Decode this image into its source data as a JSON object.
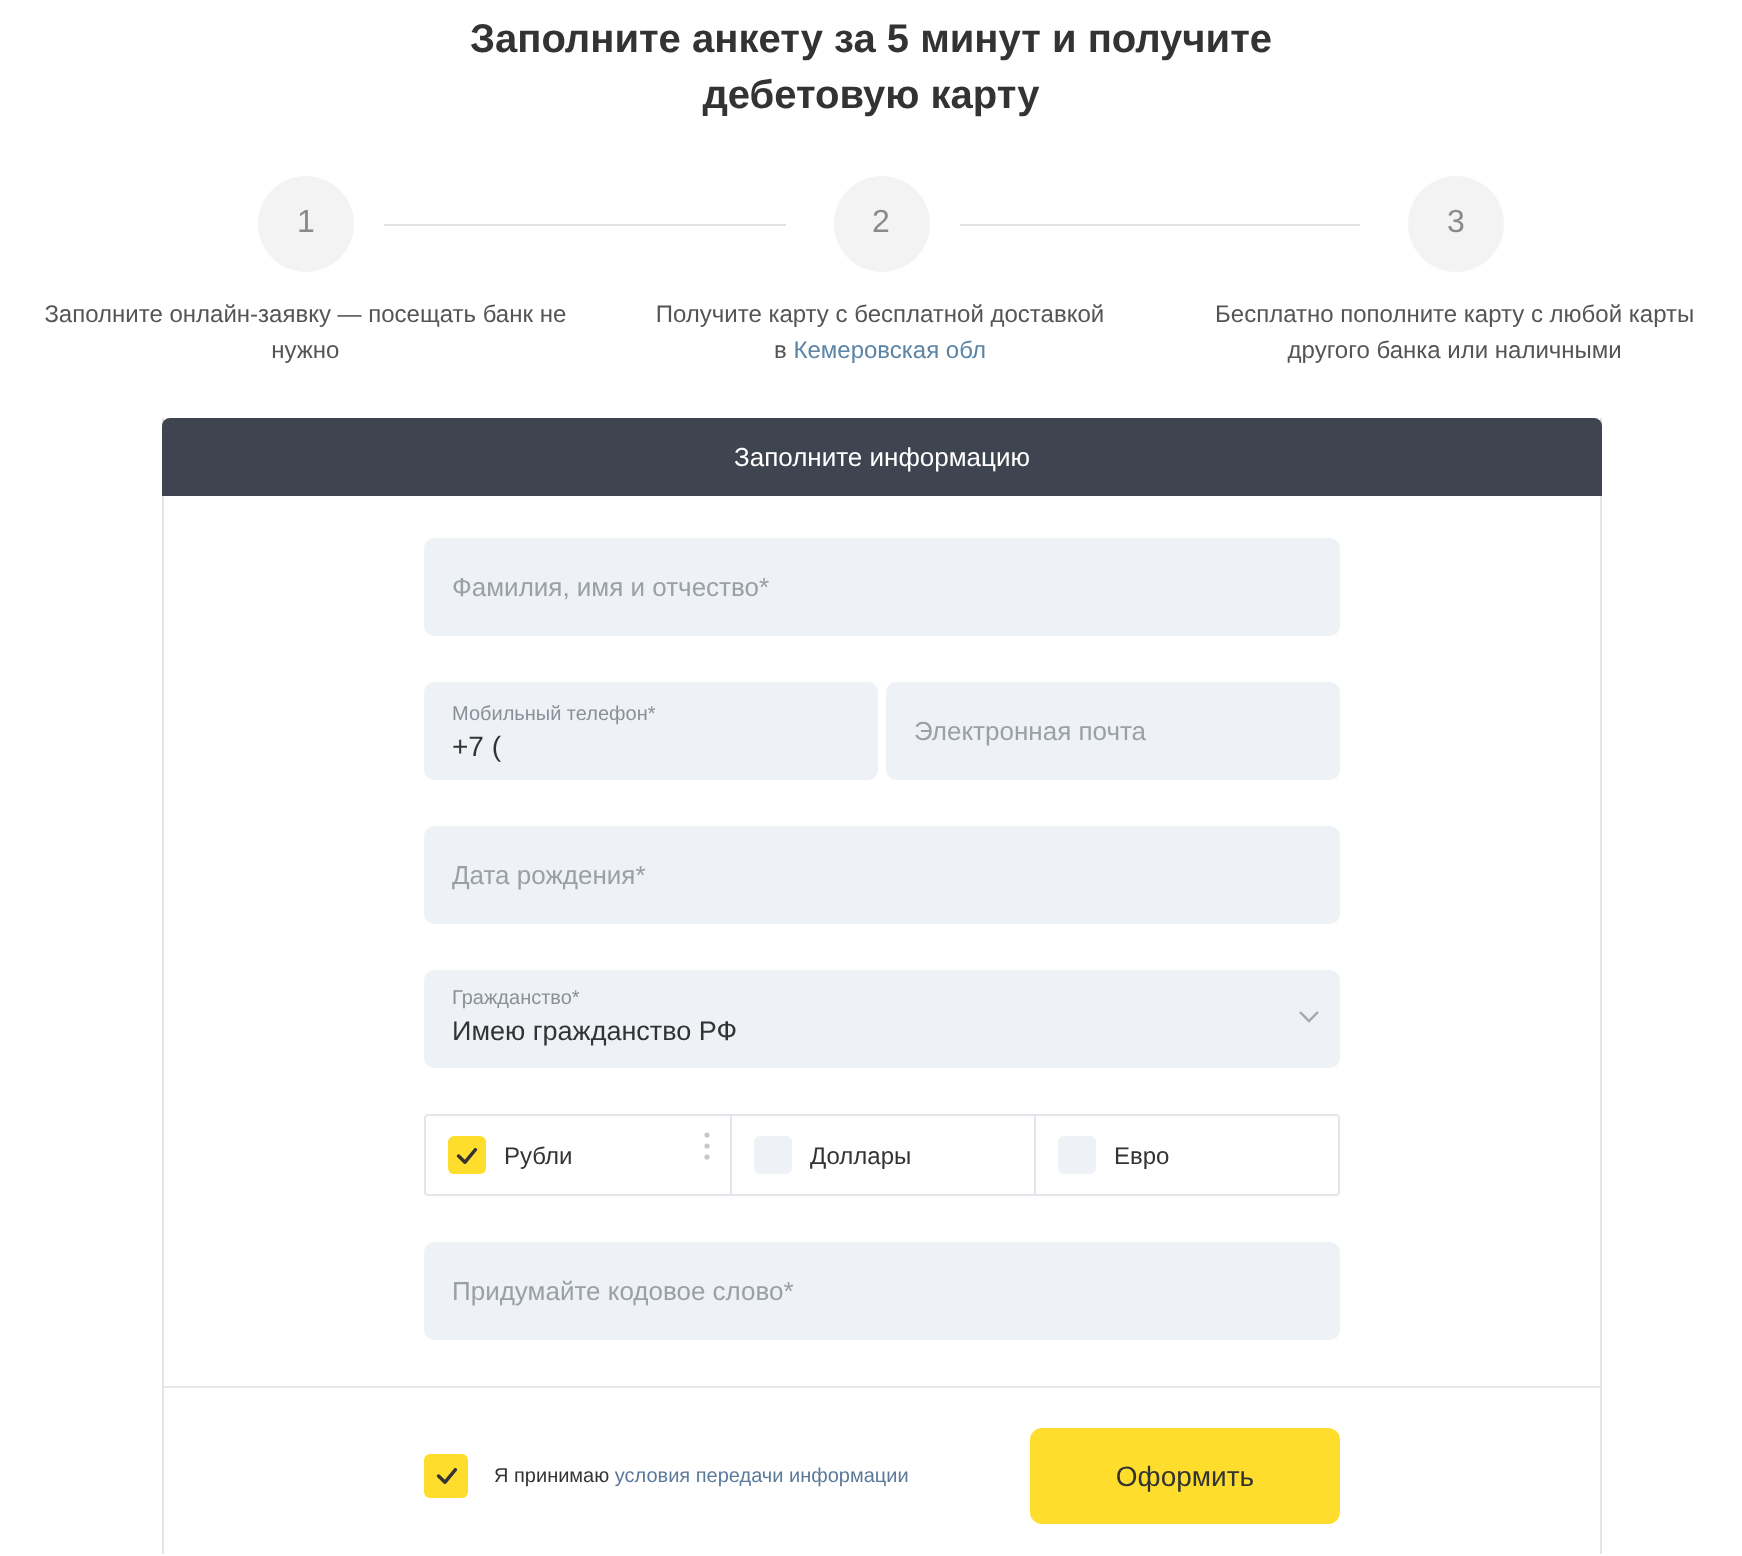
{
  "heading": "Заполните анкету за 5 минут и получите дебетовую карту",
  "steps": [
    {
      "number": "1",
      "text": "Заполните онлайн-заявку — посещать банк не нужно"
    },
    {
      "number": "2",
      "text": "Получите карту с бесплатной доставкой в",
      "link": "Кемеровская обл"
    },
    {
      "number": "3",
      "text": "Бесплатно пополните карту с любой карты другого банка или наличными"
    }
  ],
  "form": {
    "title": "Заполните информацию",
    "sections": [
      {
        "kind": "fields",
        "fields": [
          {
            "kind": "input",
            "placeholder": "Фамилия, имя и отчество*"
          }
        ]
      },
      {
        "kind": "fields",
        "fields": [
          {
            "kind": "input",
            "label": "Мобильный телефон*",
            "value": "+7 ("
          },
          {
            "kind": "input",
            "placeholder": "Электронная почта"
          }
        ]
      },
      {
        "kind": "fields",
        "fields": [
          {
            "kind": "input",
            "placeholder": "Дата рождения*"
          }
        ]
      },
      {
        "kind": "fields",
        "fields": [
          {
            "kind": "select",
            "label": "Гражданство*",
            "value": "Имею гражданство РФ"
          }
        ]
      },
      {
        "kind": "currencies",
        "options": [
          {
            "label": "Рубли",
            "checked": true,
            "dots": true
          },
          {
            "label": "Доллары",
            "checked": false,
            "dots": false
          },
          {
            "label": "Евро",
            "checked": false,
            "dots": false
          }
        ]
      },
      {
        "kind": "fields",
        "fields": [
          {
            "kind": "input",
            "placeholder": "Придумайте кодовое слово*"
          }
        ]
      }
    ],
    "consent": {
      "checked": true,
      "text": "Я принимаю",
      "link": "условия передачи информации"
    },
    "submit": "Оформить"
  }
}
